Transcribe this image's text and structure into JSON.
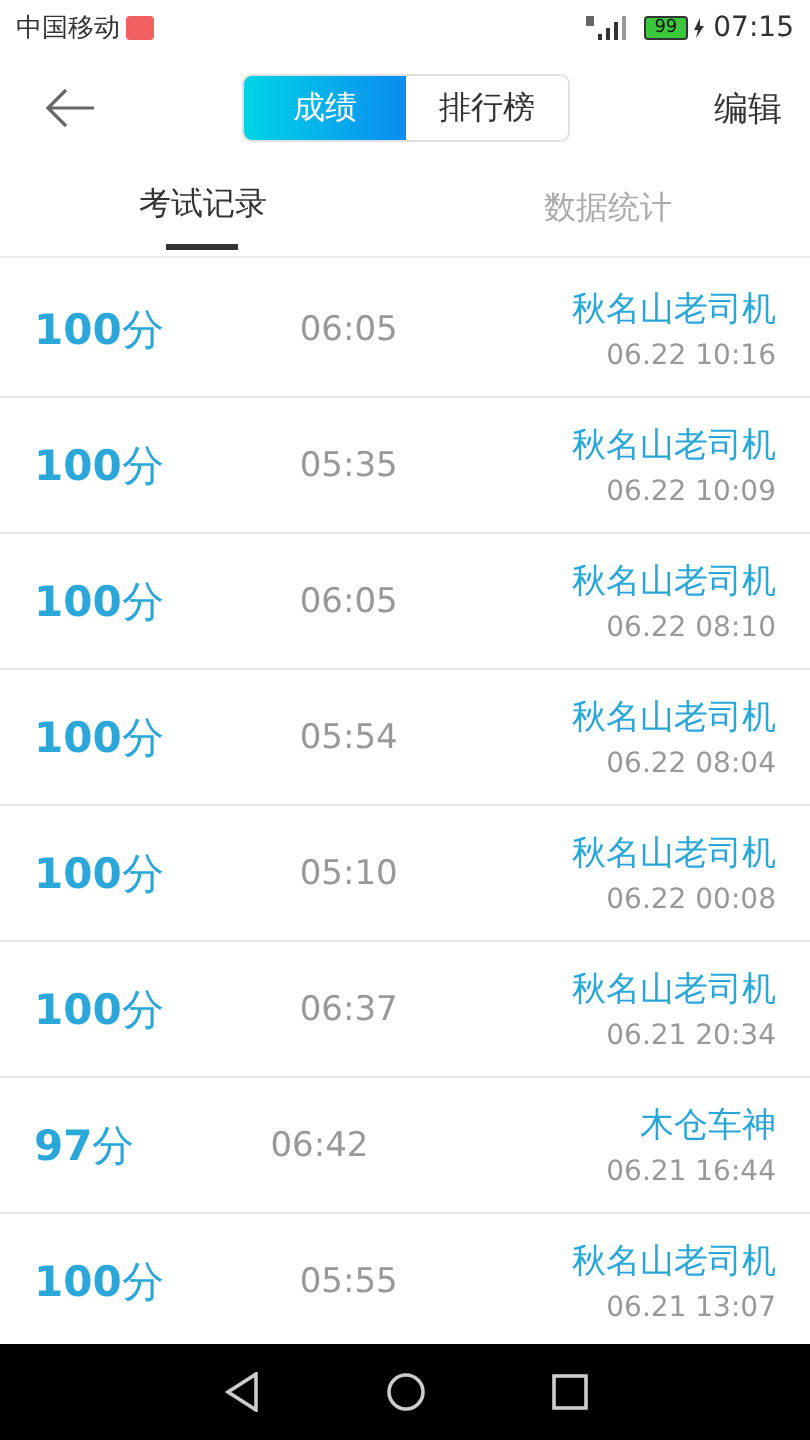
{
  "status_bar": {
    "carrier": "中国移动",
    "battery": "99",
    "time": "07:15"
  },
  "header": {
    "segments": [
      {
        "label": "成绩",
        "selected": true
      },
      {
        "label": "排行榜",
        "selected": false
      }
    ],
    "action": "编辑"
  },
  "tabs": [
    {
      "label": "考试记录",
      "selected": true
    },
    {
      "label": "数据统计",
      "selected": false
    }
  ],
  "records": [
    {
      "score": "**100**分",
      "duration": "06:05",
      "name": "秋名山老司机",
      "date": "06.22  10:16"
    },
    {
      "score": "**100**分",
      "duration": "05:35",
      "name": "秋名山老司机",
      "date": "06.22  10:09"
    },
    {
      "score": "**100**分",
      "duration": "06:05",
      "name": "秋名山老司机",
      "date": "06.22  08:10"
    },
    {
      "score": "**100**分",
      "duration": "05:54",
      "name": "秋名山老司机",
      "date": "06.22  08:04"
    },
    {
      "score": "**100**分",
      "duration": "05:10",
      "name": "秋名山老司机",
      "date": "06.22  00:08"
    },
    {
      "score": "**100**分",
      "duration": "06:37",
      "name": "秋名山老司机",
      "date": "06.21  20:34"
    },
    {
      "score": "**97**分",
      "duration": "06:42",
      "name": "木仓车神",
      "date": "06.21  16:44"
    },
    {
      "score": "**100**分",
      "duration": "05:55",
      "name": "秋名山老司机",
      "date": "06.21  13:07"
    }
  ]
}
